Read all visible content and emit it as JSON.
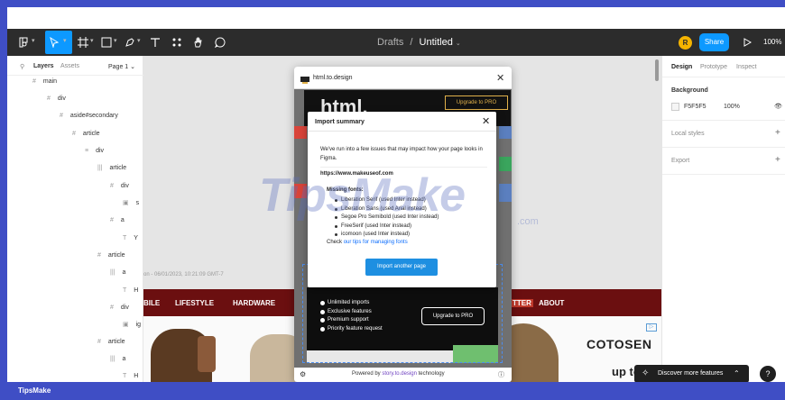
{
  "toolbar": {
    "breadcrumb": "Drafts",
    "separator": "/",
    "file_name": "Untitled",
    "avatar_initial": "R",
    "share_label": "Share",
    "zoom_level": "100%"
  },
  "left_panel": {
    "tabs": [
      "Layers",
      "Assets"
    ],
    "page": "Page 1",
    "layers": [
      {
        "label": "main",
        "icon": "#"
      },
      {
        "label": "div",
        "icon": "#"
      },
      {
        "label": "aside#secondary",
        "icon": "#"
      },
      {
        "label": "article",
        "icon": "#"
      },
      {
        "label": "div",
        "icon": "≡"
      },
      {
        "label": "article",
        "icon": "|||"
      },
      {
        "label": "div",
        "icon": "#"
      },
      {
        "label": "s",
        "icon": "▣"
      },
      {
        "label": "a",
        "icon": "#"
      },
      {
        "label": "Y",
        "icon": "T"
      },
      {
        "label": "article",
        "icon": "#"
      },
      {
        "label": "a",
        "icon": "|||"
      },
      {
        "label": "H",
        "icon": "T"
      },
      {
        "label": "div",
        "icon": "#"
      },
      {
        "label": "ig",
        "icon": "▣"
      },
      {
        "label": "article",
        "icon": "#"
      },
      {
        "label": "a",
        "icon": "|||"
      },
      {
        "label": "H",
        "icon": "T"
      }
    ]
  },
  "canvas": {
    "timestamp_text": "on - 06/01/2023, 10:21:09 GMT-7",
    "nav_items": [
      "BILE",
      "LIFESTYLE",
      "HARDWARE",
      "TTER",
      "ABOUT"
    ],
    "ad_brand": "COTOSEN",
    "ad_text": "up to"
  },
  "plugin": {
    "title": "html.to.design",
    "hero_logo": "html.",
    "hero_upgrade": "Upgrade to PRO",
    "features": [
      "Unlimited imports",
      "Exclusive features",
      "Premium support",
      "Priority feature request"
    ],
    "pro_button": "Upgrade to PRO",
    "footer_prefix": "Powered by",
    "footer_link": "story.to.design",
    "footer_suffix": "technology"
  },
  "modal": {
    "title": "Import summary",
    "intro": "We've run into a few issues that may impact how your page looks in Figma.",
    "url": "https://www.makeuseof.com",
    "missing_title": "Missing fonts:",
    "missing_fonts": [
      "Liberation Serif (used Inter instead)",
      "Liberation Sans (used Arial instead)",
      "Segoe Pro Semibold (used Inter instead)",
      "FreeSerif (used Inter instead)",
      "icomoon (used Inter instead)"
    ],
    "check_prefix": "Check",
    "check_link": "our tips for managing fonts",
    "import_button": "Import another page"
  },
  "right_panel": {
    "tabs": [
      "Design",
      "Prototype",
      "Inspect"
    ],
    "background_label": "Background",
    "background_hex": "F5F5F5",
    "background_opacity": "100%",
    "local_styles": "Local styles",
    "export": "Export"
  },
  "discover": {
    "label": "Discover more features"
  },
  "help_label": "?",
  "watermark": {
    "text": "TipsMake",
    "com": ".com"
  },
  "footer_brand": "TipsMake"
}
